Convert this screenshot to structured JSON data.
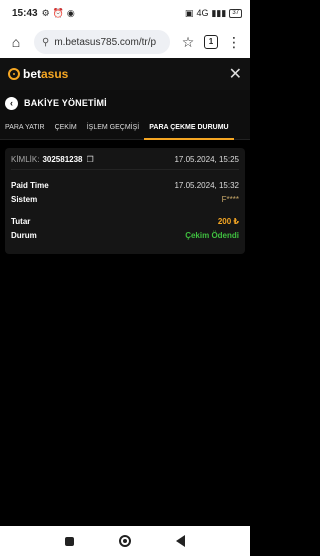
{
  "status_bar": {
    "time": "15:43",
    "battery": "37",
    "signal_text": "4G"
  },
  "browser": {
    "url": "m.betasus785.com/tr/p",
    "tabs_count": "1"
  },
  "app": {
    "logo_prefix": "bet",
    "logo_accent": "asus"
  },
  "page": {
    "title": "BAKİYE YÖNETİMİ"
  },
  "tabs": [
    {
      "label": "PARA YATIR",
      "active": false
    },
    {
      "label": "ÇEKİM",
      "active": false
    },
    {
      "label": "İŞLEM GEÇMİŞİ",
      "active": false
    },
    {
      "label": "PARA ÇEKME DURUMU",
      "active": true
    }
  ],
  "record": {
    "id_label": "KİMLİK:",
    "id_value": "302581238",
    "created_date": "17.05.2024, 15:25",
    "paid_time_label": "Paid Time",
    "paid_time_value": "17.05.2024, 15:32",
    "system_label": "Sistem",
    "system_value": "F****",
    "amount_label": "Tutar",
    "amount_value": "200 ₺",
    "status_label": "Durum",
    "status_value": "Çekim Ödendi"
  },
  "colors": {
    "accent": "#f5a623",
    "success": "#3fbf3f",
    "background": "#000000"
  }
}
